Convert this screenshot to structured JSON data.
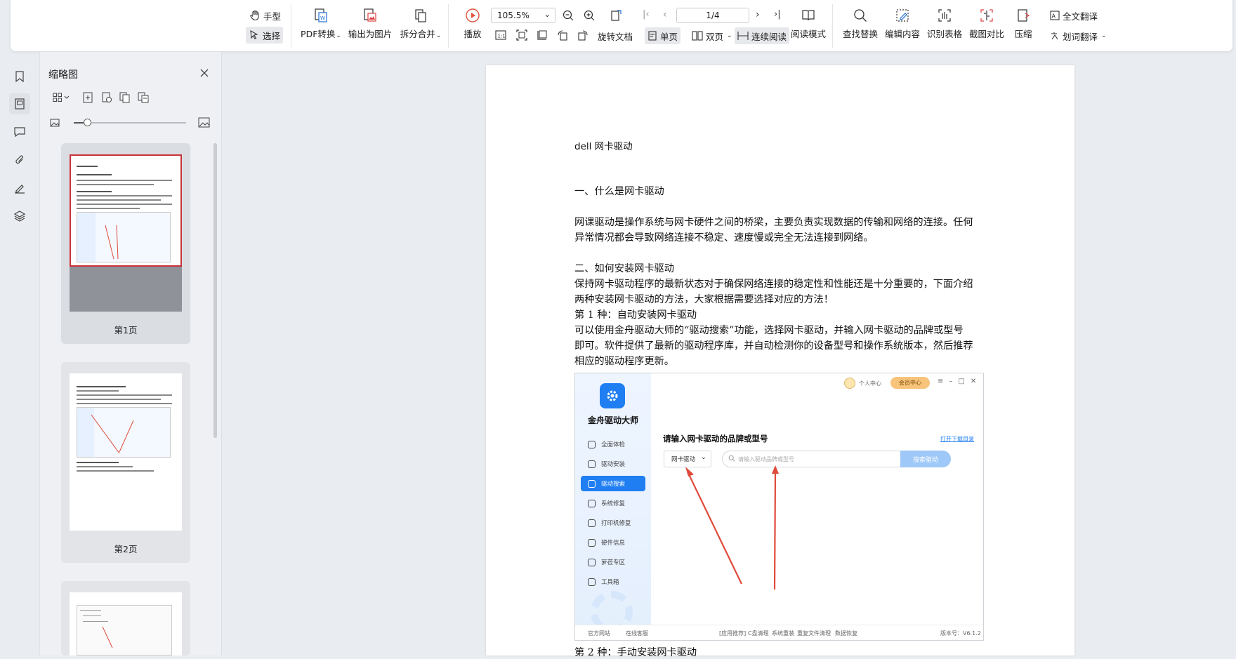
{
  "toolbar": {
    "hand": "手型",
    "select": "选择",
    "pdf_convert": "PDF转换",
    "export_image": "输出为图片",
    "split_merge": "拆分合并",
    "play": "播放",
    "zoom_value": "105.5%",
    "page_value": "1/4",
    "rotate_doc": "旋转文档",
    "single_page": "单页",
    "double_page": "双页",
    "continuous": "连续阅读",
    "reading_mode": "阅读模式",
    "find_replace": "查找替换",
    "edit_content": "编辑内容",
    "recognize_table": "识别表格",
    "screenshot_compare": "截图对比",
    "compress": "压缩",
    "full_translate": "全文翻译",
    "word_translate": "划词翻译"
  },
  "thumbnails": {
    "title": "缩略图",
    "zoom_level": 0.12,
    "pages": [
      {
        "label": "第1页",
        "selected": true
      },
      {
        "label": "第2页",
        "selected": false
      },
      {
        "label": "",
        "selected": false
      }
    ]
  },
  "document": {
    "title": "dell 网卡驱动",
    "h1": "一、什么是网卡驱动",
    "p1a": "网课驱动是操作系统与网卡硬件之间的桥梁，主要负责实现数据的传输和网络的连接。任何",
    "p1b": "异常情况都会导致网络连接不稳定、速度慢或完全无法连接到网络。",
    "h2": "二、如何安装网卡驱动",
    "p2a": "保持网卡驱动程序的最新状态对于确保网络连接的稳定性和性能还是十分重要的，下面介绍",
    "p2b": "两种安装网卡驱动的方法，大家根据需要选择对应的方法！",
    "m1": "第 1 种：自动安装网卡驱动",
    "p3a": "可以使用金舟驱动大师的“驱动搜索”功能，选择网卡驱动，并输入网卡驱动的品牌或型号",
    "p3b": "即可。软件提供了最新的驱动程序库，并自动检测你的设备型号和操作系统版本，然后推荐",
    "p3c": "相应的驱动程序更新。",
    "m2": "第 2 种：手动安装网卡驱动"
  },
  "screenshot": {
    "app_name": "金舟驱动大师",
    "user_center": "个人中心",
    "vip_center": "会员中心",
    "heading": "请输入网卡驱动的品牌或型号",
    "open_dir": "打开下载目录",
    "dropdown": "网卡驱动",
    "search_placeholder": "请输入驱动品牌或型号",
    "search_btn": "搜索驱动",
    "nav": [
      "全面体检",
      "驱动安装",
      "驱动搜索",
      "系统修复",
      "打印机修复",
      "硬件信息",
      "萝莅专区",
      "工具箱"
    ],
    "footer_site": "官方网站",
    "footer_online": "在线客服",
    "footer_app": "[应用推荐]",
    "footer_c": "C盘清理",
    "footer_reinstall": "系统重装",
    "footer_dup": "重复文件清理",
    "footer_recover": "数据恢复",
    "version": "版本号：V6.1.2"
  }
}
